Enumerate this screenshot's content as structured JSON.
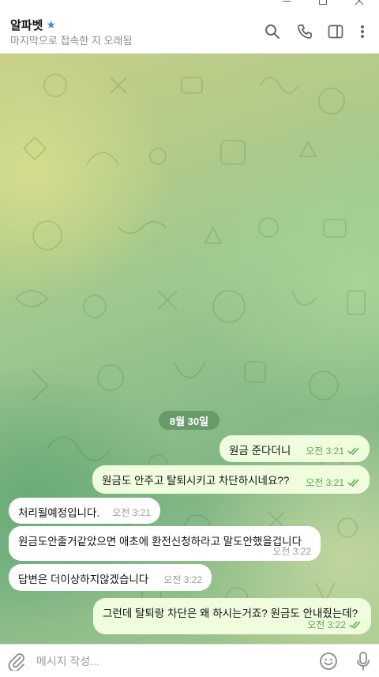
{
  "chat": {
    "name": "알파벳",
    "status": "마지막으로 접속한 지 오래됨"
  },
  "date_separator": "8월 30일",
  "messages": [
    {
      "text": "원금 준다더니",
      "time": "오전 3:21",
      "direction": "out",
      "read": true
    },
    {
      "text": "원금도 안주고 탈퇴시키고 차단하시네요??",
      "time": "오전 3:21",
      "direction": "out",
      "read": true
    },
    {
      "text": "처리될예정입니다.",
      "time": "오전 3:21",
      "direction": "in"
    },
    {
      "text": "원금도안줄거같았으면 애초에 환전신청하라고 말도안했을겁니다",
      "time": "오전 3:22",
      "direction": "in"
    },
    {
      "text": "답변은 더이상하지않겠습니다",
      "time": "오전 3:22",
      "direction": "in"
    },
    {
      "text": "그런데 탈퇴랑 차단은 왜 하시는거죠? 원금도 안내줬는데?",
      "time": "오전 3:22",
      "direction": "out",
      "read": true
    }
  ],
  "composer": {
    "placeholder": "메시지 작성...",
    "value": ""
  },
  "icons": {
    "title_badge": "star-icon",
    "header": [
      "search-icon",
      "phone-icon",
      "sidebar-toggle-icon",
      "more-vertical-icon"
    ],
    "composer": [
      "attach-icon",
      "emoji-icon",
      "microphone-icon"
    ],
    "window": [
      "minimize-icon",
      "maximize-icon",
      "close-icon"
    ]
  },
  "colors": {
    "outgoing_bubble": "#effdde",
    "incoming_bubble": "#ffffff",
    "outgoing_meta": "#5caa4e",
    "star": "#3d8fe0"
  }
}
